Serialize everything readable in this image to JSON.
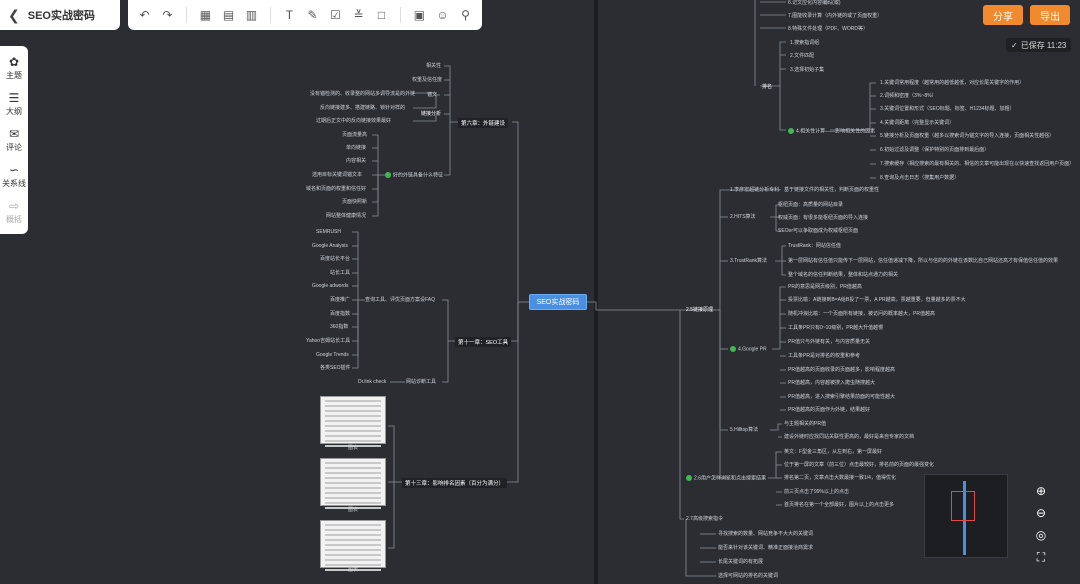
{
  "title": "SEO实战密码",
  "toolbar": {
    "icons": [
      "undo-icon",
      "redo-icon",
      "sub-topic-icon",
      "sibling-topic-icon",
      "parent-topic-icon",
      "text-icon",
      "brush-icon",
      "task-icon",
      "relation-icon",
      "frame-icon",
      "save-icon",
      "collab-icon",
      "search-icon"
    ]
  },
  "sidebar": {
    "items": [
      {
        "label": "主题"
      },
      {
        "label": "大纲"
      },
      {
        "label": "评论"
      },
      {
        "label": "关系线"
      },
      {
        "label": "概括"
      }
    ]
  },
  "actions": {
    "share": "分享",
    "export": "导出"
  },
  "autosave": "已保存 11:23",
  "root": "SEO实战密码",
  "left": {
    "ch6": "第六章：外链建设",
    "ch6_items": [
      "相关性",
      "权重及信任度",
      "锚文",
      "没有锚检测的、收录整的网站多调导流是的外链",
      "反向链接建多、搭建链路、锁针对样的",
      "过期后正文中的反向链接效果最好"
    ],
    "ch6_group2": "好的外链具备什么特征",
    "ch6_group2_items": [
      "页面流量高",
      "单向链接",
      "内容相关",
      "选用目标关键词锚文本",
      "域名和页面的权重和信任好",
      "页面快照新",
      "网站整体健康情况"
    ],
    "ch11": "第十一章：SEO工具",
    "ch11_group": "查询工具、评优页面方案设FAQ",
    "ch11_items": [
      "SEMRUSH",
      "Google Analysis",
      "百度站长平台",
      "站长工具",
      "Google adwords",
      "百度推广",
      "百度指数",
      "360指数",
      "Yahoo吉姆站长工具",
      "Google Trends",
      "各类SEO插件"
    ],
    "ch11_item2": "Dr.link check",
    "ch11_group2": "网站诊断工具",
    "ch13": "第十三章：影响排名因素（百分为满分）",
    "thumb_caption": "图表"
  },
  "right": {
    "top_items": [
      "6.记文应化内容编码(或)",
      "7.图能收录计算（内外链的或了页面权重）",
      "8.特殊文件处理（PDF、WORD等）"
    ],
    "s1": "1.搜索指词组",
    "s2": "2.文件匹配",
    "s3": "3.选择初始子集",
    "rank": "排名",
    "s4": "4.相关性计算——影响相关性的因素",
    "s4_items": [
      "1.关键词常用程度（越常用的越低越低，对应长尾关键字的作用）",
      "2.词频和密度（3%~8%）",
      "3.关键词位置和形式（SEO标题、标签、H1234标题、加粗）",
      "4.关键词距离（完整显示关键词）",
      "5.链接分析及页面权重（越多以搜索词为锚文字的导入连接，页面相关性越强）",
      "6.初始过滤及调整（保护特别的页面排到最后面）",
      "7.搜索缓存（相应搜索的最有相关的、相信的文章可能出现在以快速查找返回用户页面）",
      "8.查询及点击日志（搜集用户数据）"
    ],
    "link": "2.5链接原理",
    "l1": "1.李彦宏超链分析专利",
    "l1_desc": "基于链接文件的相关性，判断页面的权重性",
    "l2": "2.HITS算法",
    "l2_items": [
      "枢纽页面：高质量的网站目录",
      "权威页面：有很多能枢纽页面的导入连接",
      "SEOer可以争取面成为权威枢纽页面"
    ],
    "l3": "3.TrustRank算法",
    "l3_items": [
      "TrustRank：网站信任值",
      "第一层网站有信任值只能传下一层网站，信任值递减下降，所以与信的的外链在该数比自己网站还高才有保值信任值的效果",
      "整个域名的信任判断结果，整体和站点通力的相关"
    ],
    "l4": "4.Google PR",
    "l4_items": [
      "PR的意思是网页级别，PR值越高",
      "投票比喻：A链接到B=A给B投了一票，A PR越高，票越重要，但量越多的票不大",
      "随机冲浪比喻：一个页面所有链接，被访问的概率越大，PR值越高",
      "工具条PR只有0~10级别，PR越大升值越慢",
      "PR值只与外链有关，与内容质量无关",
      "工具条PR是对排名的权重和参考",
      "PR值越高的页面收录的页面越多，影响程度越高",
      "PR值越高，内容越被搜入爬虫随搜越大",
      "PR值越高，进入搜索引擎结果前面的可能性越大",
      "PR值越高的页面作为外链，结果越好"
    ],
    "l5": "5.Hilltop算法",
    "l5_items": [
      "与主题相关的PR值",
      "建设外链时应找同站关联性更高的，最好是来自专家的文档"
    ],
    "l6": "2.6用户怎样浏览和点击搜索结果",
    "l6_items": [
      "英文：F型金三角区，从左到右，第一屏最好",
      "位于第一屏的文章（前三位）点击最较好，排名前的页面的最强变化",
      "排名第二页，文章点击大数最接一致1/4，值得优化",
      "前三页点击了99%以上的点击",
      "首页排名在第一个全部最好，图片以上的点击更多"
    ],
    "l7": "2.7高级搜索指令",
    "l7_items": [
      "寻找搜索的数量、网站竞争不大大的关键词",
      "能否来针对该关键词、精准正面接洽商需求",
      "长尾关键词的有拓展",
      "选择可网站的排名的关键词"
    ]
  }
}
